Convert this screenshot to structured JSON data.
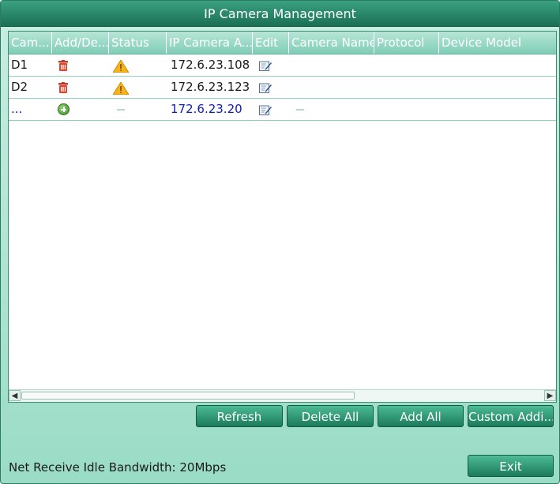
{
  "window": {
    "title": "IP Camera Management"
  },
  "table": {
    "columns": [
      "Cam...",
      "Add/De...",
      "Status",
      "IP Camera A...",
      "Edit",
      "Camera Name",
      "Protocol",
      "Device Model"
    ],
    "rows": [
      {
        "camera": "D1",
        "action_icon": "delete-icon",
        "status_icon": "warning-icon",
        "ip": "172.6.23.108",
        "edit_icon": "edit-icon",
        "camera_name": "",
        "protocol": "",
        "device_model": ""
      },
      {
        "camera": "D2",
        "action_icon": "delete-icon",
        "status_icon": "warning-icon",
        "ip": "172.6.23.123",
        "edit_icon": "edit-icon",
        "camera_name": "",
        "protocol": "",
        "device_model": ""
      },
      {
        "camera": "...",
        "action_icon": "add-icon",
        "status_icon": "dash-icon",
        "ip": "172.6.23.20",
        "edit_icon": "edit-icon",
        "camera_name": "",
        "protocol": "",
        "device_model": ""
      }
    ]
  },
  "buttons": {
    "refresh": "Refresh",
    "delete_all": "Delete All",
    "add_all": "Add All",
    "custom_add": "Custom Addi...",
    "exit": "Exit"
  },
  "status": {
    "bandwidth": "Net Receive Idle Bandwidth: 20Mbps"
  },
  "colors": {
    "title_bar": "#1b6f55",
    "background": "#9adcc6",
    "pending_text": "#1020a8"
  }
}
